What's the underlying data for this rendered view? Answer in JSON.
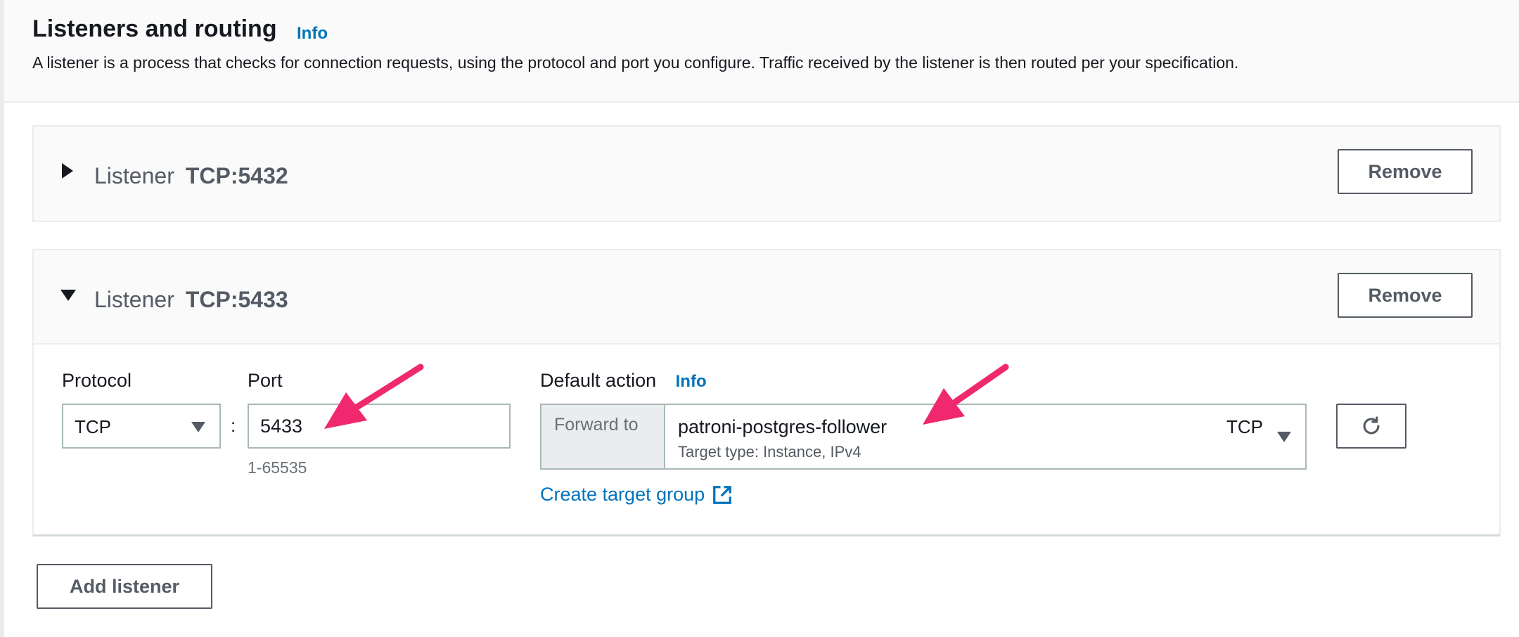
{
  "header": {
    "title": "Listeners and routing",
    "info": "Info",
    "description": "A listener is a process that checks for connection requests, using the protocol and port you configure. Traffic received by the listener is then routed per your specification."
  },
  "listeners": [
    {
      "label": "Listener",
      "name": "TCP:5432",
      "expanded": false,
      "remove_label": "Remove"
    },
    {
      "label": "Listener",
      "name": "TCP:5433",
      "expanded": true,
      "remove_label": "Remove",
      "protocol_label": "Protocol",
      "protocol_value": "TCP",
      "port_label": "Port",
      "port_value": "5433",
      "port_hint": "1-65535",
      "default_action_label": "Default action",
      "default_action_info": "Info",
      "forward_label": "Forward to",
      "target_group_name": "patroni-postgres-follower",
      "target_type": "Target type: Instance, IPv4",
      "target_protocol": "TCP",
      "create_target_group": "Create target group"
    }
  ],
  "footer": {
    "add_listener": "Add listener"
  },
  "icons": {
    "collapsed": "caret-right-icon",
    "expanded": "caret-down-icon",
    "dropdown": "caret-down-icon",
    "refresh": "refresh-icon",
    "external": "external-link-icon"
  },
  "colors": {
    "link": "#0073bb",
    "text": "#16191f",
    "muted": "#545b64",
    "annotation_arrow": "#f0296f"
  }
}
